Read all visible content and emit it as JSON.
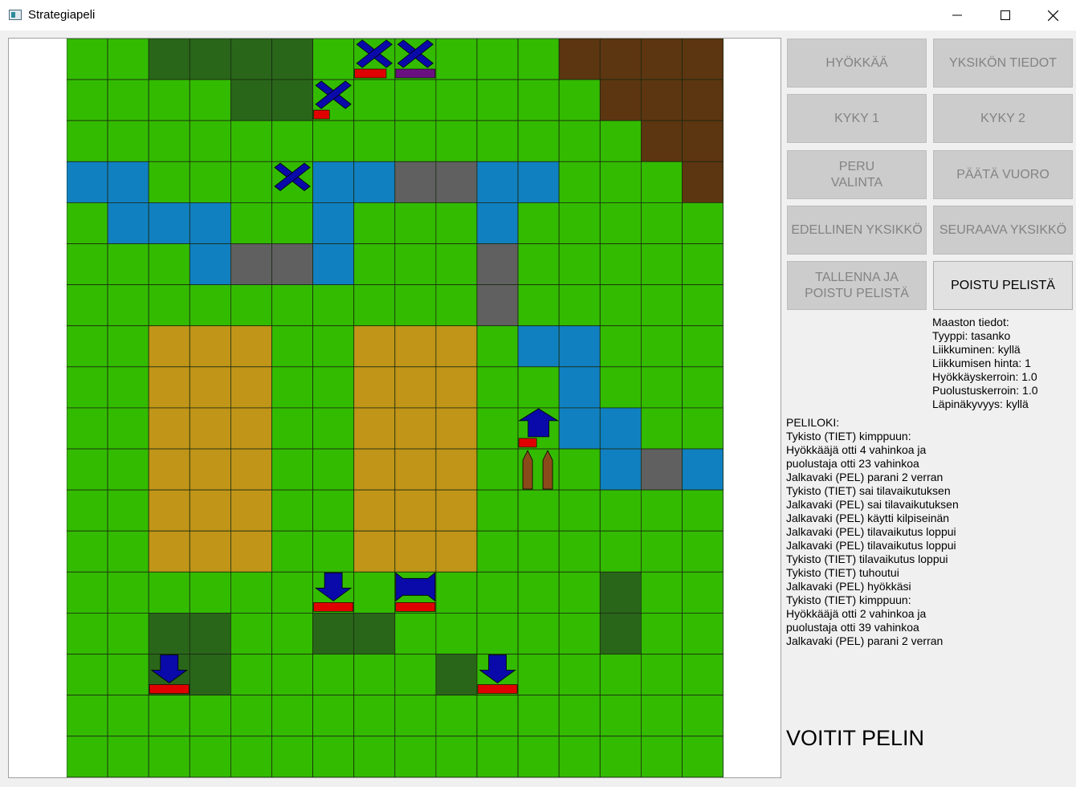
{
  "window": {
    "title": "Strategiapeli",
    "controls": [
      "minimize-icon",
      "maximize-icon",
      "close-icon"
    ]
  },
  "map": {
    "cols": 16,
    "rows": 18,
    "terrain_rows": [
      "GGDDDDGGGGGGBBBB",
      "GGGGDDGGGGGGGBBB",
      "GGGGGGGGGGGGGGBB",
      "WWGGGGWWRRWWGGGB",
      "GWWWGGWGGGWGGGGG",
      "GGGWRRWGGGRGGGGG",
      "GGGGGGGGGGRGGGGG",
      "GGSSSGGSSSGWWGGG",
      "GGSSSGGSSSGGWGGG",
      "GGSSSGGSSSGGWWGG",
      "GGSSSGGSSSGGGWRW",
      "GGSSSGGSSSGGGGGG",
      "GGSSSGGSSSGGGGGG",
      "GGGGGGGGGGGGGDGG",
      "GGDDGGDDGGGGGDGG",
      "GGDDGGGGGDGGGGGG",
      "GGGGGGGGGGGGGGGG",
      "GGGGGGGGGGGGGGGG"
    ],
    "terrain_colors": {
      "G": "#33bb00",
      "D": "#29661a",
      "B": "#5c3511",
      "W": "#1080c0",
      "R": "#606060",
      "S": "#c09518"
    },
    "units": [
      {
        "type": "x-unit",
        "col": 7,
        "row": 0,
        "hp": 0.8,
        "bar_color": "#e00000"
      },
      {
        "type": "x-unit",
        "col": 8,
        "row": 0,
        "hp": 1.0,
        "bar_color": "#6a1080"
      },
      {
        "type": "x-unit",
        "col": 6,
        "row": 1,
        "hp": 0.4,
        "bar_color": "#e00000"
      },
      {
        "type": "x-unit",
        "col": 5,
        "row": 3,
        "hp": 0,
        "bar_color": "#e00000"
      },
      {
        "type": "arrow-up-unit",
        "col": 11,
        "row": 9,
        "hp": 0.45,
        "bar_color": "#e00000"
      },
      {
        "type": "stakes",
        "col": 11,
        "row": 10,
        "hp": 0,
        "bar_color": "#e00000"
      },
      {
        "type": "arrow-down-unit",
        "col": 6,
        "row": 13,
        "hp": 1.0,
        "bar_color": "#e00000"
      },
      {
        "type": "bowtie-unit",
        "col": 8,
        "row": 13,
        "hp": 1.0,
        "bar_color": "#e00000"
      },
      {
        "type": "arrow-down-unit",
        "col": 2,
        "row": 15,
        "hp": 1.0,
        "bar_color": "#e00000"
      },
      {
        "type": "arrow-down-unit",
        "col": 10,
        "row": 15,
        "hp": 1.0,
        "bar_color": "#e00000"
      }
    ],
    "unit_color": "#0a0aaa"
  },
  "buttons": [
    {
      "id": "attack",
      "label": "HYÖKKÄÄ",
      "enabled": false
    },
    {
      "id": "unit-info",
      "label": "YKSIKÖN TIEDOT",
      "enabled": false
    },
    {
      "id": "ability-1",
      "label": "KYKY 1",
      "enabled": false
    },
    {
      "id": "ability-2",
      "label": "KYKY 2",
      "enabled": false
    },
    {
      "id": "cancel-selection",
      "label": "PERU\nVALINTA",
      "enabled": false
    },
    {
      "id": "end-turn",
      "label": "PÄÄTÄ VUORO",
      "enabled": false
    },
    {
      "id": "previous-unit",
      "label": "EDELLINEN YKSIKKÖ",
      "enabled": false
    },
    {
      "id": "next-unit",
      "label": "SEURAAVA YKSIKKÖ",
      "enabled": false
    },
    {
      "id": "save-and-exit",
      "label": "TALLENNA JA\nPOISTU PELISTÄ",
      "enabled": false
    },
    {
      "id": "exit-game",
      "label": "POISTU PELISTÄ",
      "enabled": true
    }
  ],
  "terrain_info": [
    "Maaston tiedot:",
    "Tyyppi: tasanko",
    "Liikkuminen: kyllä",
    "Liikkumisen hinta: 1",
    "Hyökkäyskerroin: 1.0",
    "Puolustuskerroin: 1.0",
    "Läpinäkyvyys: kyllä"
  ],
  "game_log": [
    "PELILOKI:",
    "Tykisto (TIET) kimppuun:",
    "Hyökkääjä otti 4 vahinkoa ja",
    "puolustaja otti 23 vahinkoa",
    "Jalkavaki (PEL) parani 2 verran",
    "Tykisto (TIET) sai tilavaikutuksen",
    "Jalkavaki (PEL) sai tilavaikutuksen",
    "Jalkavaki (PEL) käytti kilpiseinän",
    "Jalkavaki (PEL) tilavaikutus loppui",
    "Jalkavaki (PEL) tilavaikutus loppui",
    "Tykisto (TIET) tilavaikutus loppui",
    "Tykisto (TIET) tuhoutui",
    "Jalkavaki (PEL) hyökkäsi",
    "Tykisto (TIET) kimppuun:",
    "Hyökkääjä otti 2 vahinkoa ja",
    "puolustaja otti 39 vahinkoa",
    "Jalkavaki (PEL) parani 2 verran"
  ],
  "victory_text": "VOITIT PELIN"
}
